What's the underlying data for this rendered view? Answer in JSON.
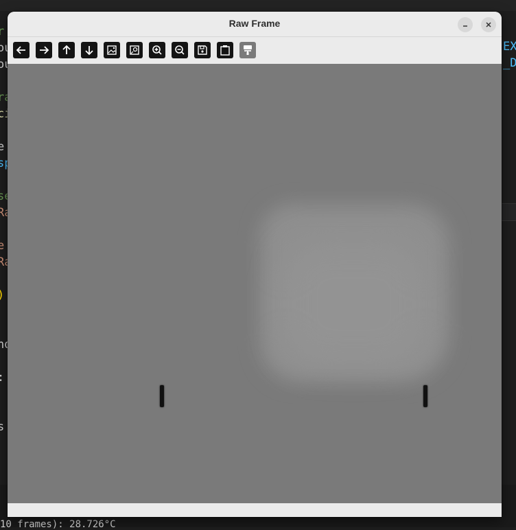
{
  "window": {
    "title": "Raw Frame"
  },
  "toolbar": {
    "buttons": [
      {
        "name": "back-icon",
        "enabled": true
      },
      {
        "name": "forward-icon",
        "enabled": true
      },
      {
        "name": "pan-up-icon",
        "enabled": true
      },
      {
        "name": "pan-down-icon",
        "enabled": true
      },
      {
        "name": "image-icon",
        "enabled": true
      },
      {
        "name": "zoom-to-fit-icon",
        "enabled": true
      },
      {
        "name": "zoom-in-icon",
        "enabled": true
      },
      {
        "name": "zoom-out-icon",
        "enabled": true
      },
      {
        "name": "save-icon",
        "enabled": true
      },
      {
        "name": "copy-to-clipboard-icon",
        "enabled": true
      },
      {
        "name": "properties-icon",
        "enabled": false
      }
    ]
  },
  "background_editor": {
    "left_fragments": [
      {
        "text": "r",
        "color": "#6a9955"
      },
      {
        "text": "ou",
        "color": "#d4d4d4"
      },
      {
        "text": "ou",
        "color": "#d4d4d4"
      },
      {
        "text": "",
        "color": "#d4d4d4"
      },
      {
        "text": "ra",
        "color": "#6a9955"
      },
      {
        "text": "ci",
        "color": "#dcdcaa"
      },
      {
        "text": "",
        "color": "#d4d4d4"
      },
      {
        "text": "e",
        "color": "#d4d4d4"
      },
      {
        "text": "sp",
        "color": "#4fc1ff"
      },
      {
        "text": "",
        "color": "#d4d4d4"
      },
      {
        "text": "se",
        "color": "#6a9955"
      },
      {
        "text": "Ra",
        "color": "#ce9178"
      },
      {
        "text": "",
        "color": "#d4d4d4"
      },
      {
        "text": "e",
        "color": "#ce9178"
      },
      {
        "text": "Ra",
        "color": "#ce9178"
      },
      {
        "text": "",
        "color": "#d4d4d4"
      },
      {
        "text": ")",
        "color": "#ffd700"
      },
      {
        "text": "",
        "color": "#d4d4d4"
      },
      {
        "text": "",
        "color": "#d4d4d4"
      },
      {
        "text": "nd",
        "color": "#d4d4d4"
      },
      {
        "text": "",
        "color": "#d4d4d4"
      },
      {
        "text": ":",
        "color": "#d4d4d4"
      },
      {
        "text": "",
        "color": "#d4d4d4"
      },
      {
        "text": "",
        "color": "#d4d4d4"
      },
      {
        "text": "s",
        "color": "#d4d4d4"
      }
    ],
    "right_fragments": [
      {
        "text": "EX",
        "color": "#4fc1ff"
      },
      {
        "text": "_D",
        "color": "#4fc1ff"
      }
    ],
    "status_text": "10 frames): 28.726°C"
  },
  "canvas": {
    "description_colors": {
      "background": "#7a7a7a",
      "warm_region": "#8f8f8f",
      "markers": "#111111"
    }
  }
}
